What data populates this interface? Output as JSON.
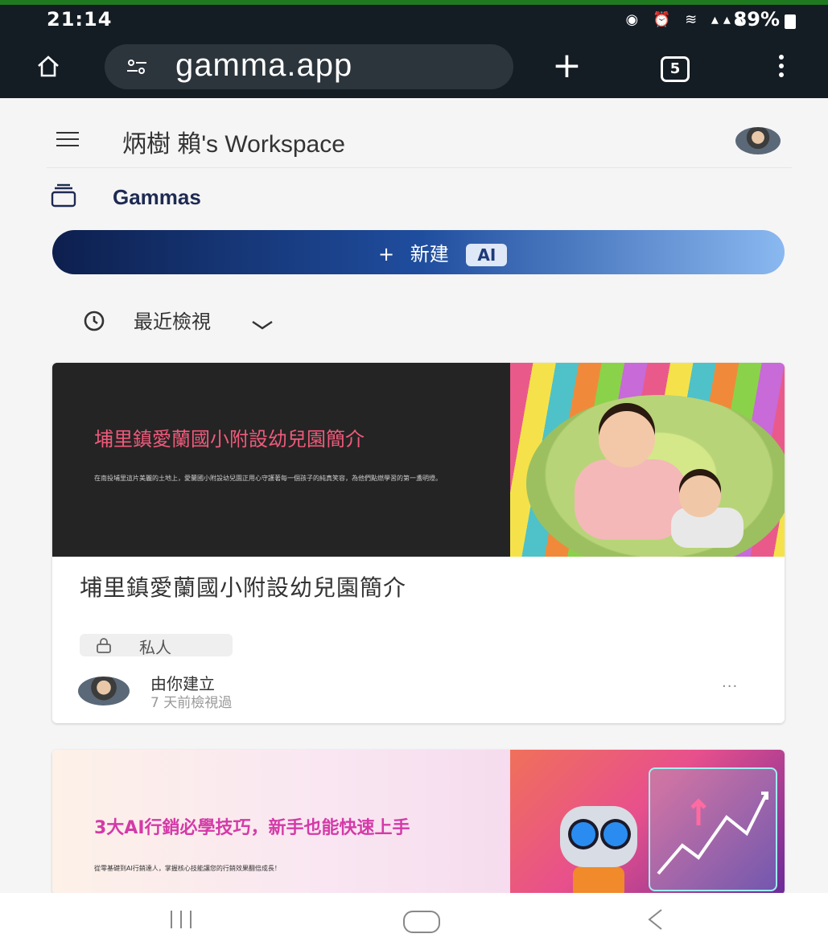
{
  "status_bar": {
    "time": "21:14",
    "battery": "89%",
    "indicators": "camera alarm wifi VoLTE signal"
  },
  "browser": {
    "url": "gamma.app",
    "tab_count": "5",
    "plus_label": "+"
  },
  "header": {
    "workspace_title": "炳樹 賴's Workspace"
  },
  "section": {
    "title": "Gammas"
  },
  "new_button": {
    "label": "新建",
    "badge": "AI"
  },
  "filter": {
    "label": "最近檢視"
  },
  "cards": [
    {
      "thumb_title": "埔里鎮愛蘭國小附設幼兒園簡介",
      "thumb_subtitle": "在南投埔里這片美麗的土地上，愛蘭國小附設幼兒園正用心守護著每一個孩子的純真笑容，為他們點燃學習的第一盞明燈。",
      "title": "埔里鎮愛蘭國小附設幼兒園簡介",
      "visibility": "私人",
      "creator": "由你建立",
      "viewed": "7 天前檢視過",
      "more": "···"
    },
    {
      "thumb_title": "3大AI行銷必學技巧，新手也能快速上手",
      "thumb_subtitle": "從零基礎到AI行銷達人，掌握核心技能讓您的行銷效果翻倍成長！"
    }
  ],
  "icons": {
    "home": "home-icon",
    "tune": "site-settings-icon",
    "menu": "hamburger-icon",
    "gammas": "stack-icon",
    "clock": "clock-icon",
    "lock": "lock-icon"
  }
}
